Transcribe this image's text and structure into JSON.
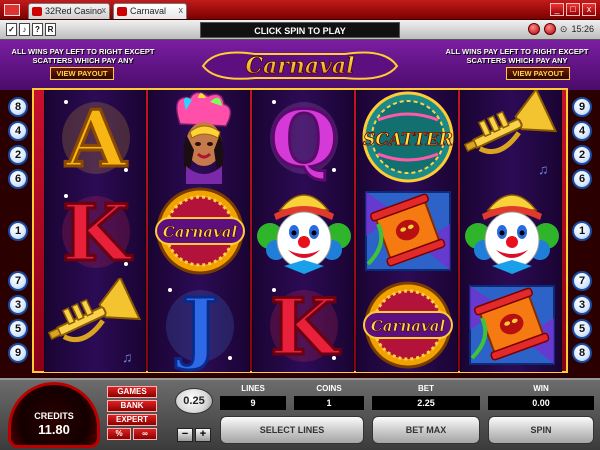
{
  "browser": {
    "tabs": [
      {
        "label": "32Red Casino"
      },
      {
        "label": "Carnaval"
      }
    ],
    "close_glyph": "x",
    "window_buttons": [
      "_",
      "□",
      "x"
    ]
  },
  "toolbar": {
    "icons": [
      "✓",
      "♪",
      "?",
      "R"
    ],
    "message": "CLICK SPIN TO PLAY",
    "time": "15:26"
  },
  "banner": {
    "note_left": "ALL WINS PAY LEFT TO RIGHT EXCEPT SCATTERS WHICH PAY ANY",
    "note_right": "ALL WINS PAY LEFT TO RIGHT EXCEPT SCATTERS WHICH PAY ANY",
    "view_payout_left": "VIEW PAYOUT",
    "view_payout_right": "VIEW PAYOUT",
    "logo_text": "Carnaval"
  },
  "paylines": {
    "left": [
      "8",
      "4",
      "2",
      "6",
      "1",
      "7",
      "3",
      "5",
      "9"
    ],
    "right": [
      "9",
      "4",
      "2",
      "6",
      "1",
      "7",
      "3",
      "5",
      "8"
    ]
  },
  "reels": [
    [
      "letter-a",
      "letter-k",
      "trumpet"
    ],
    [
      "carnival-dancer",
      "carnaval-logo",
      "letter-j"
    ],
    [
      "letter-q",
      "clown",
      "letter-k"
    ],
    [
      "scatter",
      "drum",
      "carnaval-logo"
    ],
    [
      "trumpet",
      "clown",
      "drum"
    ]
  ],
  "symbols": {
    "scatter_text": "SCATTER",
    "logo_text": "Carnaval",
    "letter_a": "A",
    "letter_k": "K",
    "letter_j": "J",
    "letter_q": "Q"
  },
  "panel": {
    "credits_label": "CREDITS",
    "credits_value": "11.80",
    "games": "GAMES",
    "bank": "BANK",
    "expert": "EXPERT",
    "percent": "%",
    "coin_value": "0.25",
    "minus": "−",
    "plus": "+",
    "lines_label": "LINES",
    "lines_value": "9",
    "coins_label": "COINS",
    "coins_value": "1",
    "bet_label": "BET",
    "bet_value": "2.25",
    "win_label": "WIN",
    "win_value": "0.00",
    "select_lines": "SELECT LINES",
    "bet_max": "BET MAX",
    "spin": "SPIN"
  },
  "colors": {
    "frame_red": "#c8102e",
    "gold": "#ffcc33",
    "purple": "#4b0b6b"
  }
}
